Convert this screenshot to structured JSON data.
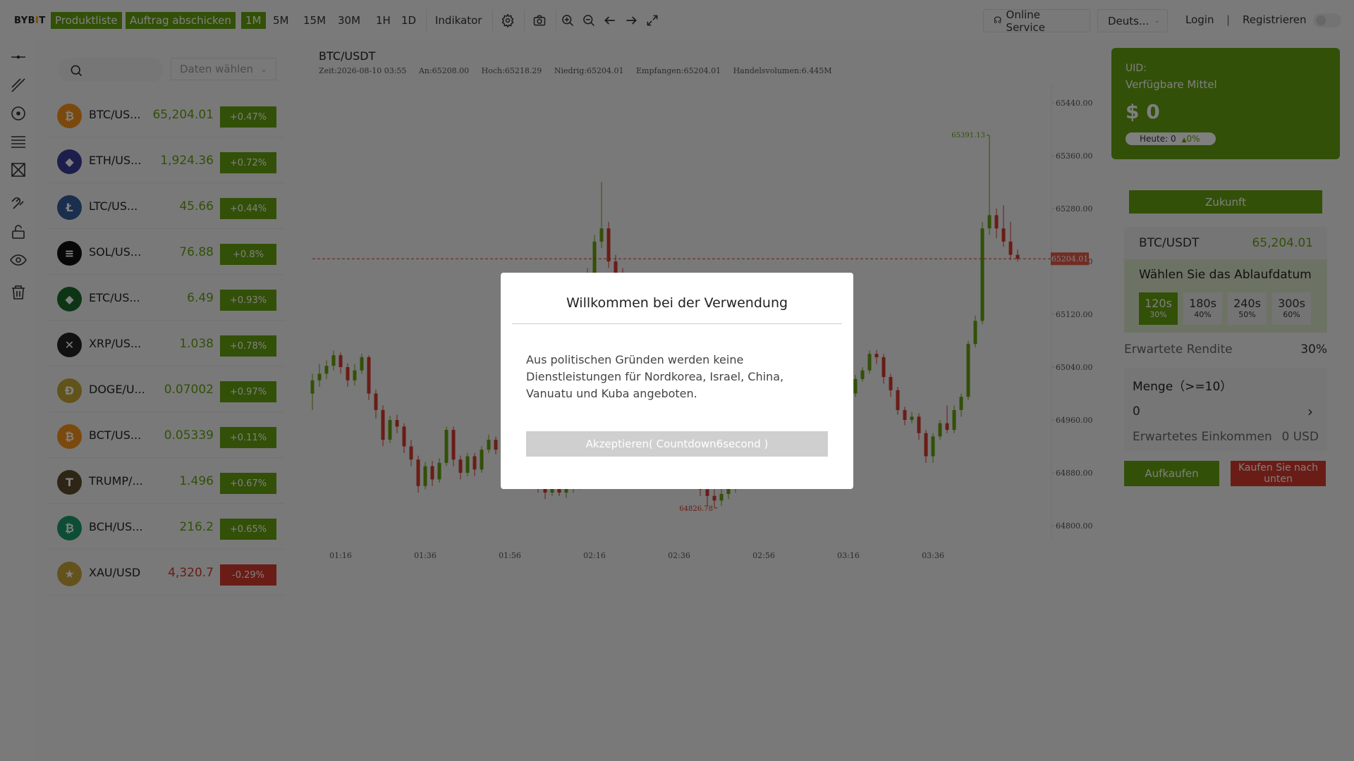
{
  "topbar": {
    "logo": "BYBIT",
    "product_list": "Produktliste",
    "submit_order": "Auftrag abschicken",
    "timeframes": [
      "1M",
      "5M",
      "15M",
      "30M",
      "1H",
      "1D"
    ],
    "active_timeframe": "1M",
    "indicator": "Indikator",
    "online_service": "Online Service",
    "language": "Deuts...",
    "login": "Login",
    "divider": "|",
    "register": "Registrieren"
  },
  "market": {
    "search_placeholder": "",
    "select_label": "Daten wählen",
    "rows": [
      {
        "name": "BTC/US...",
        "price": "65,204.01",
        "change": "+0.47%",
        "dir": "up",
        "icon": "bitcoin-icon",
        "color": "#f7931a",
        "glyph": "₿"
      },
      {
        "name": "ETH/US...",
        "price": "1,924.36",
        "change": "+0.72%",
        "dir": "up",
        "icon": "ethereum-icon",
        "color": "#3c3c9a",
        "glyph": "◆"
      },
      {
        "name": "LTC/US...",
        "price": "45.66",
        "change": "+0.44%",
        "dir": "up",
        "icon": "litecoin-icon",
        "color": "#345d9d",
        "glyph": "Ł"
      },
      {
        "name": "SOL/US...",
        "price": "76.88",
        "change": "+0.8%",
        "dir": "up",
        "icon": "solana-icon",
        "color": "#111111",
        "glyph": "≡"
      },
      {
        "name": "ETC/US...",
        "price": "6.49",
        "change": "+0.93%",
        "dir": "up",
        "icon": "ethereum-classic-icon",
        "color": "#1a6b2a",
        "glyph": "◆"
      },
      {
        "name": "XRP/US...",
        "price": "1.038",
        "change": "+0.78%",
        "dir": "up",
        "icon": "xrp-icon",
        "color": "#222222",
        "glyph": "✕"
      },
      {
        "name": "DOGE/U...",
        "price": "0.07002",
        "change": "+0.97%",
        "dir": "up",
        "icon": "dogecoin-icon",
        "color": "#c2a633",
        "glyph": "Ð"
      },
      {
        "name": "BCT/US...",
        "price": "0.05339",
        "change": "+0.11%",
        "dir": "up",
        "icon": "bitcoin-icon",
        "color": "#f7931a",
        "glyph": "₿"
      },
      {
        "name": "TRUMP/...",
        "price": "1.496",
        "change": "+0.67%",
        "dir": "up",
        "icon": "trump-coin-icon",
        "color": "#5a4a2a",
        "glyph": "T"
      },
      {
        "name": "BCH/US...",
        "price": "216.2",
        "change": "+0.65%",
        "dir": "up",
        "icon": "bitcoin-cash-icon",
        "color": "#1a9a6a",
        "glyph": "₿"
      },
      {
        "name": "XAU/USD",
        "price": "4,320.7",
        "change": "-0.29%",
        "dir": "down",
        "icon": "gold-flag-icon",
        "color": "#c9a43a",
        "glyph": "★"
      }
    ]
  },
  "chart": {
    "title": "BTC/USDT",
    "info": {
      "time": "Zeit:2026-08-10 03:55",
      "open": "An:65208.00",
      "high": "Hoch:65218.29",
      "low": "Niedrig:65204.01",
      "close": "Empfangen:65204.01",
      "volume": "Handelsvolumen:6.445M"
    },
    "current_price_label": "65204.01",
    "high_marker": "65391.13",
    "low_marker": "64826.78"
  },
  "chart_data": {
    "type": "candlestick",
    "title": "BTC/USDT",
    "x_ticks": [
      "01:16",
      "01:36",
      "01:56",
      "02:16",
      "02:36",
      "02:56",
      "03:16",
      "03:36"
    ],
    "y_ticks": [
      "65440.00",
      "65360.00",
      "65280.00",
      "65200.00",
      "65120.00",
      "65040.00",
      "64960.00",
      "64880.00",
      "64800.00"
    ],
    "ylim": [
      64800,
      65440
    ],
    "current_price": 65204.01,
    "high": 65391.13,
    "low": 64826.78,
    "candles": [
      [
        65000,
        65020,
        64975,
        65030
      ],
      [
        65020,
        65030,
        65010,
        65045
      ],
      [
        65030,
        65042,
        65022,
        65050
      ],
      [
        65042,
        65058,
        65035,
        65065
      ],
      [
        65058,
        65040,
        65030,
        65062
      ],
      [
        65040,
        65020,
        65010,
        65046
      ],
      [
        65020,
        65035,
        65012,
        65045
      ],
      [
        65035,
        65055,
        65030,
        65060
      ],
      [
        65055,
        65000,
        64990,
        65058
      ],
      [
        65000,
        64975,
        64962,
        65006
      ],
      [
        64975,
        64930,
        64920,
        64982
      ],
      [
        64930,
        64960,
        64925,
        64966
      ],
      [
        64960,
        64950,
        64940,
        64968
      ],
      [
        64950,
        64920,
        64910,
        64955
      ],
      [
        64920,
        64900,
        64890,
        64930
      ],
      [
        64900,
        64860,
        64850,
        64906
      ],
      [
        64860,
        64890,
        64855,
        64896
      ],
      [
        64890,
        64870,
        64860,
        64898
      ],
      [
        64870,
        64895,
        64865,
        64902
      ],
      [
        64895,
        64945,
        64890,
        64950
      ],
      [
        64945,
        64900,
        64890,
        64950
      ],
      [
        64900,
        64880,
        64870,
        64906
      ],
      [
        64880,
        64905,
        64875,
        64910
      ],
      [
        64905,
        64885,
        64875,
        64910
      ],
      [
        64885,
        64915,
        64880,
        64920
      ],
      [
        64915,
        64930,
        64910,
        64938
      ],
      [
        64930,
        64915,
        64908,
        64935
      ],
      [
        64915,
        64935,
        64910,
        64940
      ],
      [
        64935,
        64920,
        64912,
        64940
      ],
      [
        64920,
        64905,
        64898,
        64925
      ],
      [
        64905,
        64925,
        64900,
        64930
      ],
      [
        64925,
        64915,
        64905,
        64932
      ],
      [
        64915,
        64870,
        64850,
        64920
      ],
      [
        64870,
        64850,
        64840,
        64876
      ],
      [
        64850,
        64858,
        64845,
        64865
      ],
      [
        64858,
        64850,
        64845,
        64862
      ],
      [
        64850,
        64856,
        64842,
        64862
      ],
      [
        64856,
        64860,
        64850,
        64866
      ],
      [
        64860,
        64990,
        64855,
        65010
      ],
      [
        64990,
        65170,
        64985,
        65190
      ],
      [
        65170,
        65230,
        65160,
        65240
      ],
      [
        65230,
        65250,
        65220,
        65320
      ],
      [
        65250,
        65200,
        65190,
        65260
      ],
      [
        65200,
        65180,
        65170,
        65210
      ],
      [
        65180,
        65140,
        65130,
        65190
      ],
      [
        65140,
        65100,
        65090,
        65150
      ],
      [
        65100,
        65060,
        65050,
        65110
      ],
      [
        65060,
        65020,
        65010,
        65070
      ],
      [
        65020,
        64990,
        64980,
        65030
      ],
      [
        64990,
        64970,
        64960,
        65000
      ],
      [
        64970,
        64950,
        64940,
        64980
      ],
      [
        64950,
        64930,
        64920,
        64960
      ],
      [
        64930,
        64910,
        64900,
        64940
      ],
      [
        64910,
        64890,
        64880,
        64920
      ],
      [
        64890,
        64870,
        64860,
        64900
      ],
      [
        64870,
        64855,
        64845,
        64880
      ],
      [
        64855,
        64845,
        64830,
        64865
      ],
      [
        64845,
        64838,
        64827,
        64855
      ],
      [
        64838,
        64848,
        64830,
        64856
      ],
      [
        64848,
        64860,
        64840,
        64868
      ],
      [
        64860,
        64880,
        64850,
        64890
      ],
      [
        64880,
        64900,
        64870,
        64910
      ],
      [
        64900,
        64920,
        64890,
        64930
      ],
      [
        64920,
        64945,
        64910,
        64955
      ],
      [
        64945,
        64970,
        64935,
        64980
      ],
      [
        64970,
        64990,
        64960,
        65000
      ],
      [
        64990,
        65010,
        64980,
        65020
      ],
      [
        65010,
        65030,
        65000,
        65040
      ],
      [
        65030,
        65025,
        65015,
        65040
      ],
      [
        65025,
        65035,
        65018,
        65042
      ],
      [
        65035,
        65030,
        65022,
        65040
      ],
      [
        65030,
        65025,
        65018,
        65036
      ],
      [
        65025,
        65030,
        65020,
        65036
      ],
      [
        65030,
        65022,
        65015,
        65034
      ],
      [
        65022,
        65025,
        65018,
        65030
      ],
      [
        65025,
        65020,
        65010,
        65030
      ],
      [
        65020,
        65000,
        64995,
        65028
      ],
      [
        65000,
        65022,
        64995,
        65028
      ],
      [
        65022,
        65035,
        65018,
        65040
      ],
      [
        65035,
        65060,
        65030,
        65065
      ],
      [
        65060,
        65055,
        65045,
        65066
      ],
      [
        65055,
        65025,
        65015,
        65060
      ],
      [
        65025,
        65005,
        64995,
        65030
      ],
      [
        65005,
        64975,
        64968,
        65010
      ],
      [
        64975,
        64960,
        64952,
        64980
      ],
      [
        64960,
        64965,
        64955,
        64972
      ],
      [
        64965,
        64940,
        64930,
        64970
      ],
      [
        64940,
        64905,
        64895,
        64945
      ],
      [
        64905,
        64935,
        64895,
        64940
      ],
      [
        64935,
        64955,
        64930,
        64960
      ],
      [
        64955,
        64945,
        64940,
        64982
      ],
      [
        64945,
        64975,
        64940,
        64982
      ],
      [
        64975,
        64995,
        64965,
        65000
      ],
      [
        64995,
        65075,
        64990,
        65080
      ],
      [
        65075,
        65110,
        65070,
        65118
      ],
      [
        65110,
        65250,
        65105,
        65260
      ],
      [
        65250,
        65270,
        65240,
        65391
      ],
      [
        65270,
        65250,
        65235,
        65280
      ],
      [
        65250,
        65230,
        65222,
        65285
      ],
      [
        65230,
        65210,
        65202,
        65260
      ],
      [
        65210,
        65204,
        65200,
        65218
      ]
    ]
  },
  "balance": {
    "uid_label": "UID:",
    "available_label": "Verfügbare Mittel",
    "amount": "$ 0",
    "today_label": "Heute: 0",
    "today_pct": "0%"
  },
  "trade": {
    "future_label": "Zukunft",
    "pair": "BTC/USDT",
    "pair_price": "65,204.01",
    "expiry_title": "Wählen Sie das Ablaufdatum",
    "options": [
      {
        "time": "120s",
        "pct": "30%",
        "active": true
      },
      {
        "time": "180s",
        "pct": "40%",
        "active": false
      },
      {
        "time": "240s",
        "pct": "50%",
        "active": false
      },
      {
        "time": "300s",
        "pct": "60%",
        "active": false
      }
    ],
    "expected_return_label": "Erwartete Rendite",
    "expected_return_value": "30%",
    "quantity_label": "Menge（>=10）",
    "quantity_value": "0",
    "expected_income_label": "Erwartetes Einkommen",
    "expected_income_value": "0 USD",
    "buy_up_label": "Aufkaufen",
    "buy_down_label": "Kaufen Sie nach unten"
  },
  "modal": {
    "title": "Willkommen bei der Verwendung",
    "body": "Aus politischen Gründen werden keine Dienstleistungen für Nordkorea, Israel, China, Vanuatu und Kuba angeboten.",
    "accept_label": "Akzeptieren( Countdown6second )"
  },
  "colors": {
    "accent_green": "#64a10f",
    "down_red": "#d33b2c"
  }
}
